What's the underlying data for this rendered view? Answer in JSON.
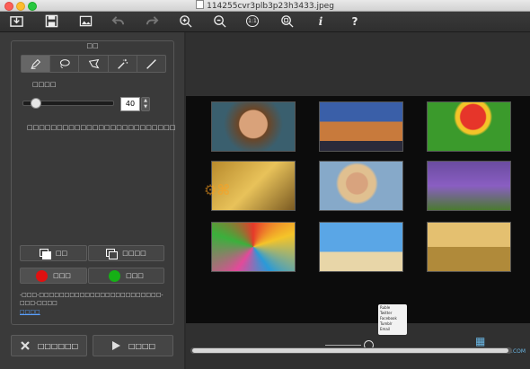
{
  "window": {
    "title": "114255cvr3plb3p23h3433.jpeg"
  },
  "toolbar": {
    "items": [
      "import-icon",
      "save-icon",
      "image-icon",
      "undo-icon",
      "redo-icon",
      "zoom-in-icon",
      "zoom-out-icon",
      "actual-size-icon",
      "fit-icon",
      "info-icon",
      "help-icon"
    ],
    "actual_size": "1:1",
    "info": "i",
    "help": "?"
  },
  "panel": {
    "title": "□□",
    "tools": [
      "brush-tool",
      "lasso-tool",
      "polygon-lasso-tool",
      "magic-wand-tool",
      "line-tool"
    ],
    "size_label": "□□□□",
    "size_value": "40",
    "hint": "□□□□□□□□□□□□□□□□□□□□□□□□□",
    "mode_a": "□□",
    "mode_b": "□□□□",
    "red_label": "□□□",
    "green_label": "□□□",
    "note": "-□□□-□□□□□□□□□□□□□□□□□□□□□□□□-□□□-□□□□",
    "link": "□□□□",
    "colors": {
      "red": "#e01010",
      "green": "#16b016",
      "link": "#5aa0ff"
    }
  },
  "actions": {
    "cancel": "□□□□□□",
    "run": "□□□□"
  },
  "preview": {
    "popup_items": [
      "Ruble",
      "Twitter",
      "Facebook",
      "Tumblr",
      "Email"
    ],
    "watermark_site": "HTTP://WWW.MACW.COM"
  }
}
